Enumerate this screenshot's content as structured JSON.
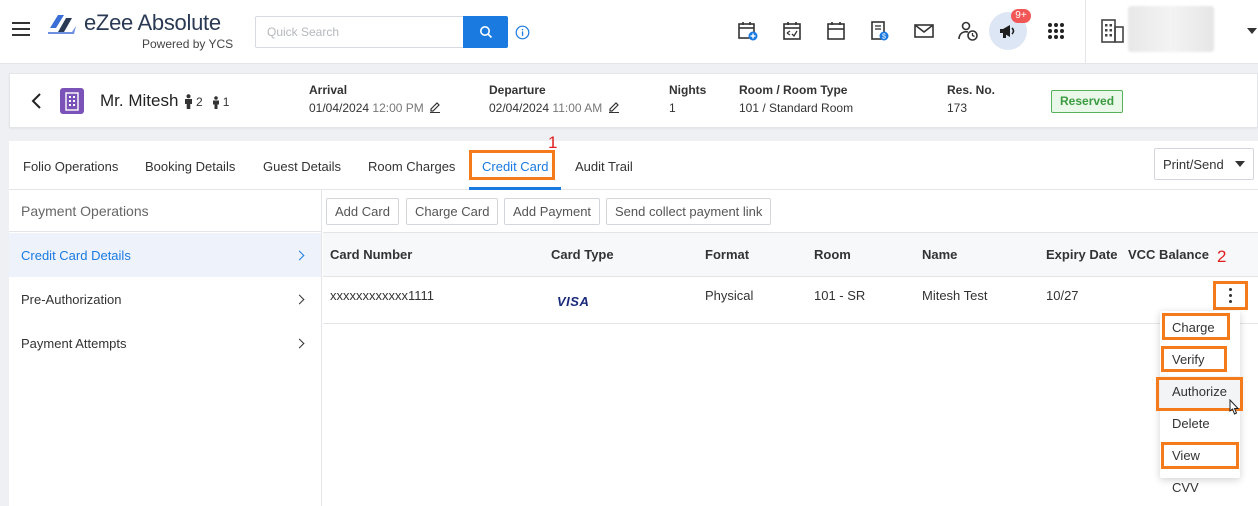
{
  "app": {
    "logo_name": "eZee Absolute",
    "logo_sub": "Powered by YCS",
    "search_placeholder": "Quick Search",
    "notification_count": "9+",
    "accent": "#1a7ae0",
    "icons": [
      "menu-icon",
      "search-icon",
      "info-icon",
      "calendar-add-icon",
      "calendar-check-icon",
      "calendar-icon",
      "invoice-dollar-icon",
      "mail-icon",
      "user-clock-icon",
      "megaphone-icon",
      "apps-grid-icon",
      "hotel-icon"
    ]
  },
  "guest": {
    "name": "Mr. Mitesh",
    "adults": "2",
    "children": "1",
    "arrival_label": "Arrival",
    "arrival_date": "01/04/2024",
    "arrival_time": "12:00 PM",
    "departure_label": "Departure",
    "departure_date": "02/04/2024",
    "departure_time": "11:00 AM",
    "nights_label": "Nights",
    "nights": "1",
    "room_label": "Room / Room Type",
    "room": "101 / Standard Room",
    "resno_label": "Res. No.",
    "resno": "173",
    "status": "Reserved"
  },
  "tabs": [
    "Folio Operations",
    "Booking Details",
    "Guest Details",
    "Room Charges",
    "Credit Card",
    "Audit Trail"
  ],
  "active_tab": "Credit Card",
  "print_label": "Print/Send",
  "sidebar": {
    "title": "Payment Operations",
    "items": [
      "Credit Card Details",
      "Pre-Authorization",
      "Payment Attempts"
    ]
  },
  "actions": [
    "Add Card",
    "Charge Card",
    "Add Payment",
    "Send collect payment link"
  ],
  "table": {
    "columns": [
      "Card Number",
      "Card Type",
      "Format",
      "Room",
      "Name",
      "Expiry Date",
      "VCC Balance"
    ],
    "rows": [
      {
        "card_number": "xxxxxxxxxxxx1111",
        "card_type": "VISA",
        "format": "Physical",
        "room": "101 - SR",
        "name": "Mitesh Test",
        "expiry": "10/27",
        "vcc_balance": ""
      }
    ]
  },
  "row_menu": [
    "Charge",
    "Verify",
    "Authorize",
    "Delete",
    "View CVV"
  ],
  "annotations": {
    "step1": "1",
    "step2": "2",
    "highlight_color": "#f47a1c"
  }
}
